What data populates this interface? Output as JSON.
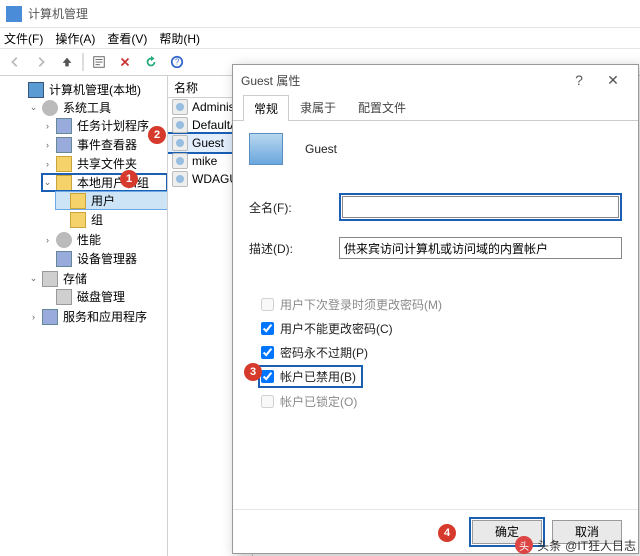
{
  "window": {
    "title": "计算机管理"
  },
  "menu": {
    "file": "文件(F)",
    "action": "操作(A)",
    "view": "查看(V)",
    "help": "帮助(H)"
  },
  "tree": {
    "root": "计算机管理(本地)",
    "systools": "系统工具",
    "task": "任务计划程序",
    "event": "事件查看器",
    "shared": "共享文件夹",
    "lusr": "本地用户和组",
    "users": "用户",
    "groups": "组",
    "perf": "性能",
    "devmgr": "设备管理器",
    "storage": "存储",
    "diskmgr": "磁盘管理",
    "svcapp": "服务和应用程序"
  },
  "list": {
    "header": "名称",
    "items": [
      "Administ",
      "DefaultA",
      "Guest",
      "mike",
      "WDAGUt"
    ]
  },
  "dlg": {
    "title": "Guest 属性",
    "tabs": {
      "general": "常规",
      "member": "隶属于",
      "profile": "配置文件"
    },
    "username": "Guest",
    "full_label": "全名(F):",
    "full_value": "",
    "desc_label": "描述(D):",
    "desc_value": "供来宾访问计算机或访问域的内置帐户",
    "chk_nextlogon": "用户下次登录时须更改密码(M)",
    "chk_cantchange": "用户不能更改密码(C)",
    "chk_neverexp": "密码永不过期(P)",
    "chk_disabled": "帐户已禁用(B)",
    "chk_locked": "帐户已锁定(O)",
    "ok": "确定",
    "cancel": "取消"
  },
  "watermark": {
    "label1": "头条",
    "label2": "@IT狂人日志"
  }
}
